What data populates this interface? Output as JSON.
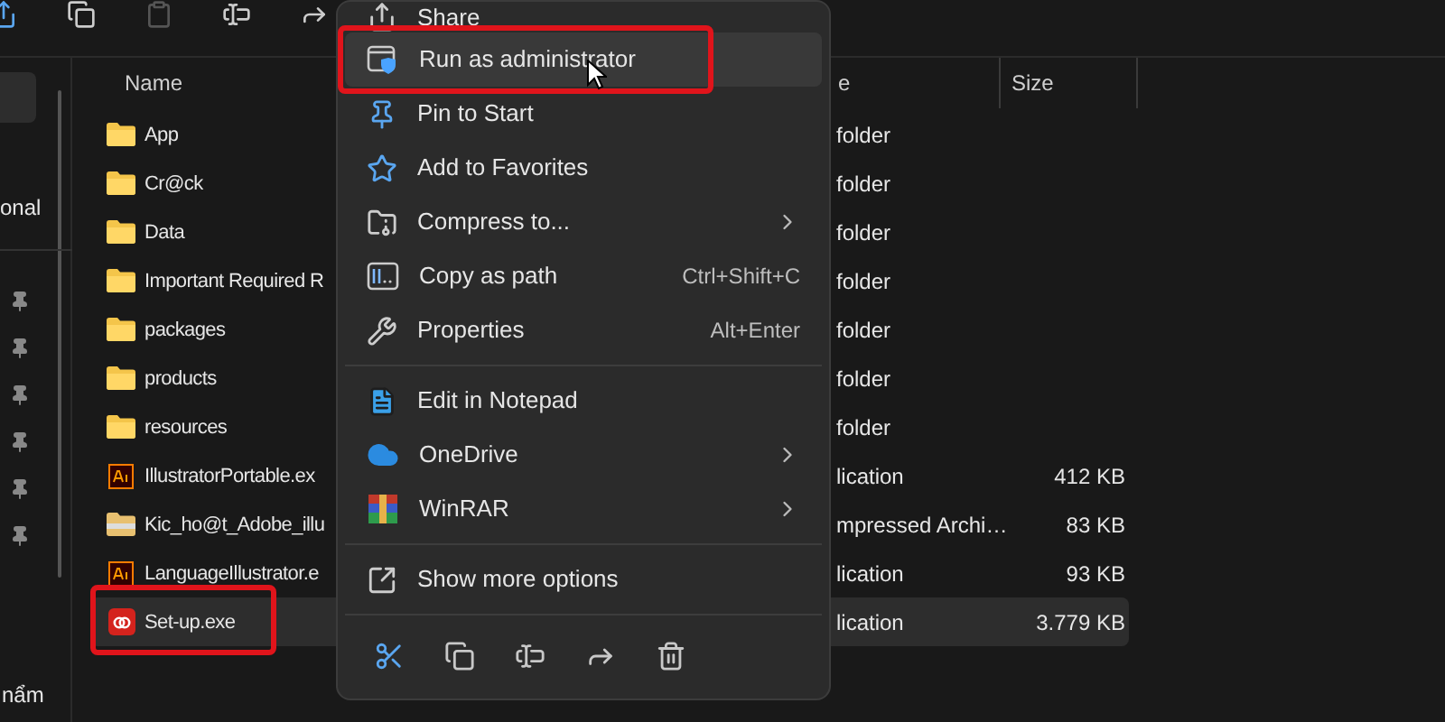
{
  "sidebar": {
    "label_top": "onal",
    "label_bottom": "nẩm"
  },
  "file_list": {
    "columns": [
      {
        "label": "Name"
      },
      {
        "label": "e"
      },
      {
        "label": "Size"
      }
    ],
    "rows": [
      {
        "kind": "folder",
        "name": "App",
        "type": "folder",
        "selected": false,
        "annotated": false
      },
      {
        "kind": "folder",
        "name": "Cr@ck",
        "type": "folder",
        "selected": false,
        "annotated": false
      },
      {
        "kind": "folder",
        "name": "Data",
        "type": "folder",
        "selected": false,
        "annotated": false
      },
      {
        "kind": "folder",
        "name": "Important Required R",
        "type": "folder",
        "selected": false,
        "annotated": false
      },
      {
        "kind": "folder",
        "name": "packages",
        "type": "folder",
        "selected": false,
        "annotated": false
      },
      {
        "kind": "folder",
        "name": "products",
        "type": "folder",
        "selected": false,
        "annotated": false
      },
      {
        "kind": "folder",
        "name": "resources",
        "type": "folder",
        "selected": false,
        "annotated": false
      },
      {
        "kind": "ai",
        "name": "IllustratorPortable.ex",
        "type": "lication",
        "size": "412 KB",
        "selected": false,
        "annotated": false
      },
      {
        "kind": "archive",
        "name": "Kic_ho@t_Adobe_illu",
        "type": "mpressed Archi…",
        "size": "83 KB",
        "selected": false,
        "annotated": false
      },
      {
        "kind": "ai",
        "name": "LanguageIllustrator.e",
        "type": "lication",
        "size": "93 KB",
        "selected": false,
        "annotated": false
      },
      {
        "kind": "setup",
        "name": "Set-up.exe",
        "type": "lication",
        "size": "3.779 KB",
        "selected": true,
        "annotated": true
      }
    ]
  },
  "context_menu": {
    "items": [
      {
        "kind": "item",
        "label": "Share",
        "hovered": false,
        "annotated": false
      },
      {
        "kind": "item",
        "label": "Run as administrator",
        "hovered": true,
        "annotated": true
      },
      {
        "kind": "item",
        "label": "Pin to Start",
        "hovered": false,
        "annotated": false
      },
      {
        "kind": "item",
        "label": "Add to Favorites",
        "hovered": false,
        "annotated": false
      },
      {
        "kind": "submenu",
        "label": "Compress to...",
        "hovered": false,
        "annotated": false
      },
      {
        "kind": "item",
        "label": "Copy as path",
        "shortcut": "Ctrl+Shift+C",
        "hovered": false,
        "annotated": false
      },
      {
        "kind": "item",
        "label": "Properties",
        "shortcut": "Alt+Enter",
        "hovered": false,
        "annotated": false
      },
      {
        "kind": "divider"
      },
      {
        "kind": "item",
        "label": "Edit in Notepad",
        "hovered": false,
        "annotated": false
      },
      {
        "kind": "submenu",
        "label": "OneDrive",
        "hovered": false,
        "annotated": false
      },
      {
        "kind": "submenu",
        "label": "WinRAR",
        "hovered": false,
        "annotated": false
      },
      {
        "kind": "divider"
      },
      {
        "kind": "item",
        "label": "Show more options",
        "hovered": false,
        "annotated": false
      },
      {
        "kind": "divider"
      },
      {
        "kind": "actions"
      }
    ]
  }
}
